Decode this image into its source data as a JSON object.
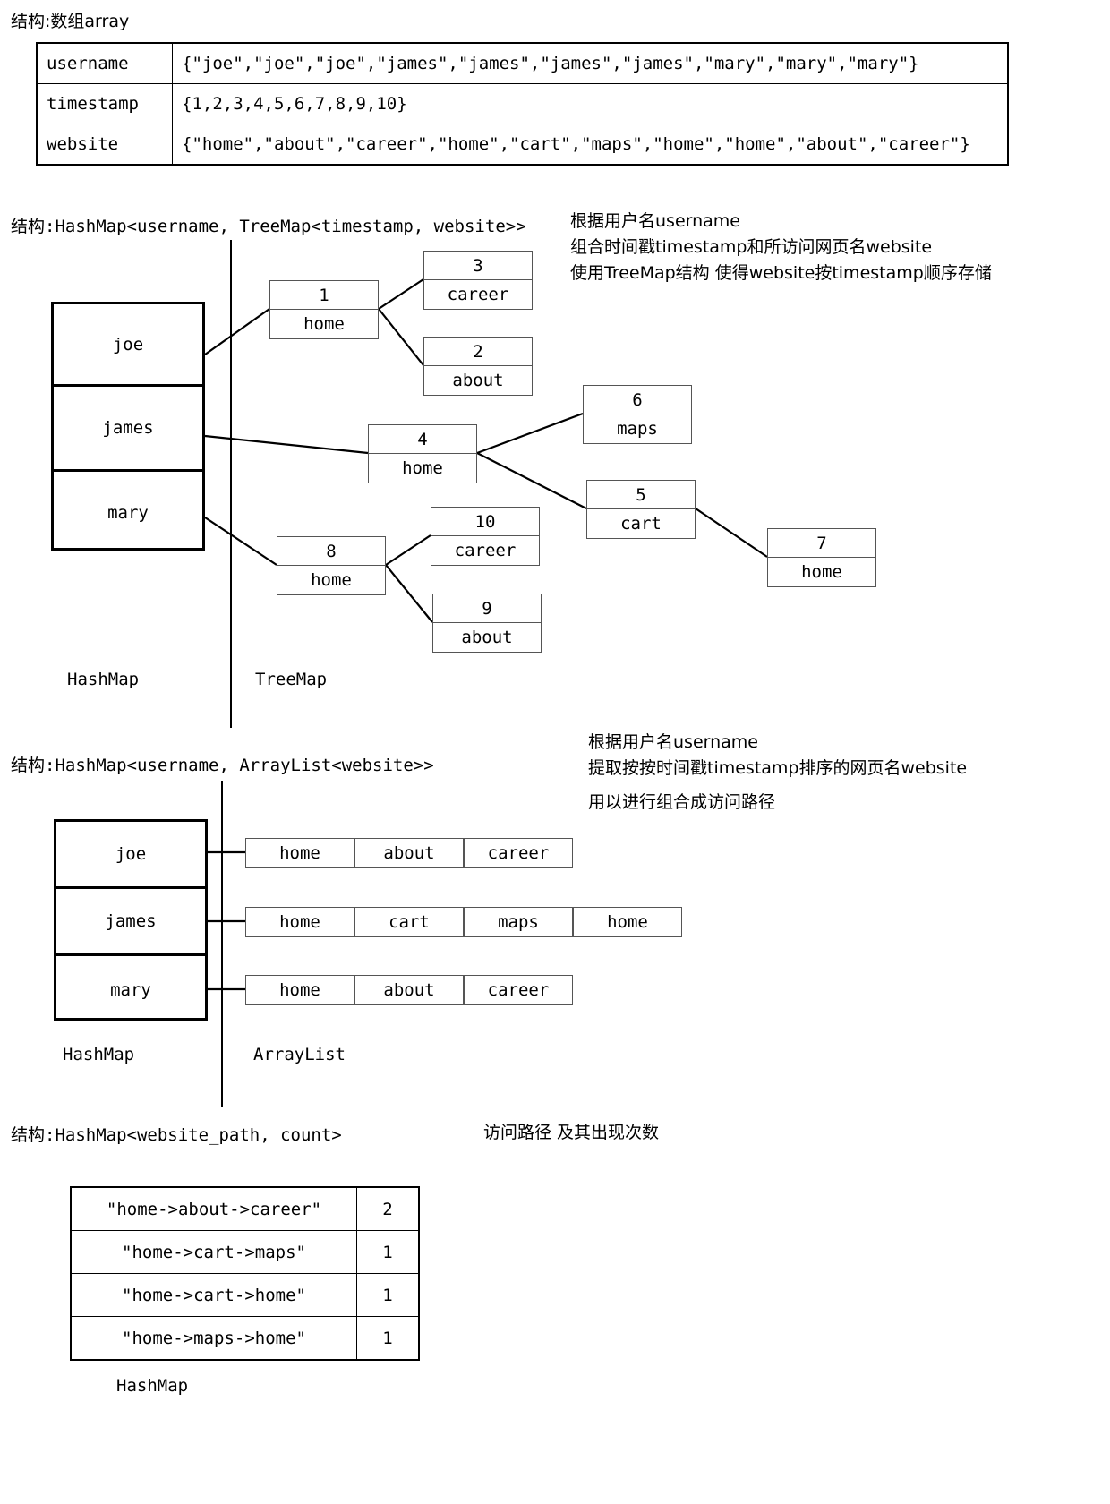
{
  "sections": {
    "array": {
      "heading": "结构:数组array",
      "rows": [
        {
          "key": "username",
          "value": "{\"joe\",\"joe\",\"joe\",\"james\",\"james\",\"james\",\"james\",\"mary\",\"mary\",\"mary\"}"
        },
        {
          "key": "timestamp",
          "value": "{1,2,3,4,5,6,7,8,9,10}"
        },
        {
          "key": "website",
          "value": "{\"home\",\"about\",\"career\",\"home\",\"cart\",\"maps\",\"home\",\"home\",\"about\",\"career\"}"
        }
      ]
    },
    "treemap": {
      "heading": "结构:HashMap<username, TreeMap<timestamp, website>>",
      "note": "根据用户名username\n组合时间戳timestamp和所访问网页名website\n使用TreeMap结构 使得website按timestamp顺序存储",
      "buckets": [
        "joe",
        "james",
        "mary"
      ],
      "left_label": "HashMap",
      "right_label": "TreeMap",
      "nodes": [
        {
          "id": "n1",
          "key": "1",
          "value": "home"
        },
        {
          "id": "n3",
          "key": "3",
          "value": "career"
        },
        {
          "id": "n2",
          "key": "2",
          "value": "about"
        },
        {
          "id": "n4",
          "key": "4",
          "value": "home"
        },
        {
          "id": "n6",
          "key": "6",
          "value": "maps"
        },
        {
          "id": "n5",
          "key": "5",
          "value": "cart"
        },
        {
          "id": "n7",
          "key": "7",
          "value": "home"
        },
        {
          "id": "n8",
          "key": "8",
          "value": "home"
        },
        {
          "id": "n10",
          "key": "10",
          "value": "career"
        },
        {
          "id": "n9",
          "key": "9",
          "value": "about"
        }
      ]
    },
    "arraylist": {
      "heading": "结构:HashMap<username, ArrayList<website>>",
      "note": "根据用户名username\n提取按按时间戳timestamp排序的网页名website",
      "note2": "用以进行组合成访问路径",
      "buckets": [
        "joe",
        "james",
        "mary"
      ],
      "left_label": "HashMap",
      "right_label": "ArrayList",
      "lists": [
        [
          "home",
          "about",
          "career"
        ],
        [
          "home",
          "cart",
          "maps",
          "home"
        ],
        [
          "home",
          "about",
          "career"
        ]
      ]
    },
    "counts": {
      "heading": "结构:HashMap<website_path, count>",
      "note": "访问路径 及其出现次数",
      "left_label": "HashMap",
      "rows": [
        {
          "path": "\"home->about->career\"",
          "count": "2"
        },
        {
          "path": "\"home->cart->maps\"",
          "count": "1"
        },
        {
          "path": "\"home->cart->home\"",
          "count": "1"
        },
        {
          "path": "\"home->maps->home\"",
          "count": "1"
        }
      ]
    }
  }
}
